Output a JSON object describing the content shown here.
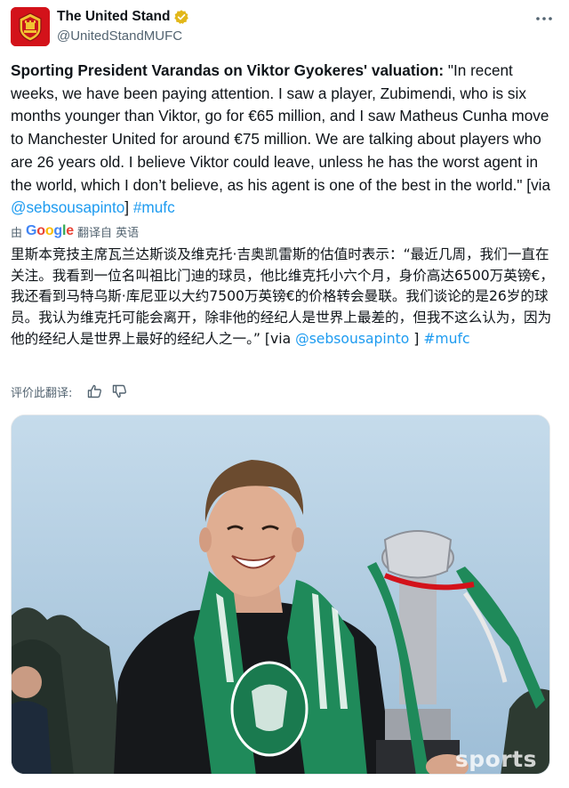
{
  "account": {
    "display_name": "The United Stand",
    "handle": "@UnitedStandMUFC",
    "verified": true,
    "avatar_color": "#d3121a"
  },
  "tweet": {
    "bold_lead": "Sporting President Varandas on Viktor Gyokeres' valuation:",
    "body": " \"In recent weeks, we have been paying attention. I saw a player, Zubimendi, who is six months younger than Viktor, go for €65 million, and I saw Matheus Cunha move to Manchester United for around €75 million. We are talking about players who are 26 years old. I believe Viktor could leave, unless he has the worst agent in the world, which I don’t believe, as his agent is one of the best in the world.\" [via ",
    "mention": "@sebsousapinto",
    "mid": "] ",
    "hashtag": "#mufc"
  },
  "translation_bar": {
    "prefix": "由",
    "google_letters": [
      "G",
      "o",
      "o",
      "g",
      "l",
      "e"
    ],
    "label": "翻译自 英语"
  },
  "translation": {
    "body": "里斯本竞技主席瓦兰达斯谈及维克托·吉奥凯雷斯的估值时表示：“最近几周，我们一直在关注。我看到一位名叫祖比门迪的球员，他比维克托小六个月，身价高达6500万英镑€，我还看到马特乌斯·库尼亚以大约7500万英镑€的价格转会曼联。我们谈论的是26岁的球员。我认为维克托可能会离开，除非他的经纪人是世界上最差的，但我不这么认为，因为他的经纪人是世界上最好的经纪人之一。” [via ",
    "mention": "@sebsousapinto",
    "mid": " ] ",
    "hashtag": "#mufc"
  },
  "rate_translation": {
    "label": "评价此翻译:",
    "icons": [
      "thumbs-up-icon",
      "thumbs-down-icon"
    ]
  },
  "media": {
    "watermark": "sports",
    "colors": {
      "sky": "#a9c8e0",
      "scarf_green": "#1f8a5a",
      "shirt": "#16181b",
      "trophy": "#b9bcc2"
    }
  },
  "colors": {
    "link": "#1d9bf0",
    "secondary_text": "#536471",
    "verified_gold": "#e2b719"
  }
}
